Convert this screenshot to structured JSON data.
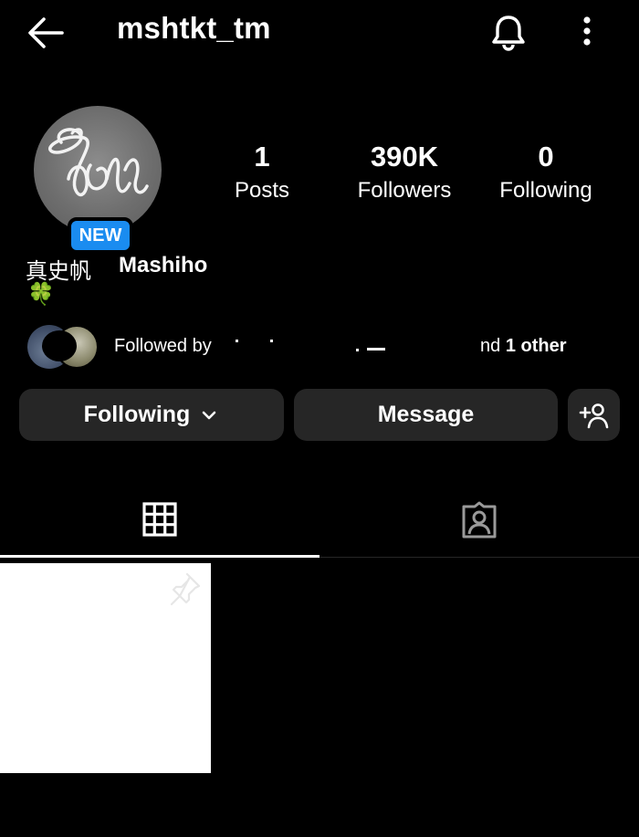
{
  "header": {
    "username": "mshtkt_tm",
    "back_icon": "arrow-left-icon",
    "bell_icon": "bell-icon",
    "more_icon": "more-vertical-icon"
  },
  "profile": {
    "avatar_icon": "profile-avatar",
    "badge": "NEW",
    "name_jp": "真史帆",
    "name_en": "Mashiho",
    "bio_emoji": "🍀"
  },
  "stats": [
    {
      "value": "1",
      "label": "Posts"
    },
    {
      "value": "390K",
      "label": "Followers"
    },
    {
      "value": "0",
      "label": "Following"
    }
  ],
  "followed_by": {
    "prefix": "Followed by",
    "suffix": "nd",
    "others": "1 other"
  },
  "buttons": {
    "following": "Following",
    "message": "Message",
    "add_user_icon": "add-user-icon"
  },
  "tabs": {
    "grid_icon": "grid-icon",
    "tagged_icon": "tagged-icon"
  },
  "colors": {
    "background": "#000000",
    "button": "#262626",
    "badge": "#1a8cf0"
  }
}
